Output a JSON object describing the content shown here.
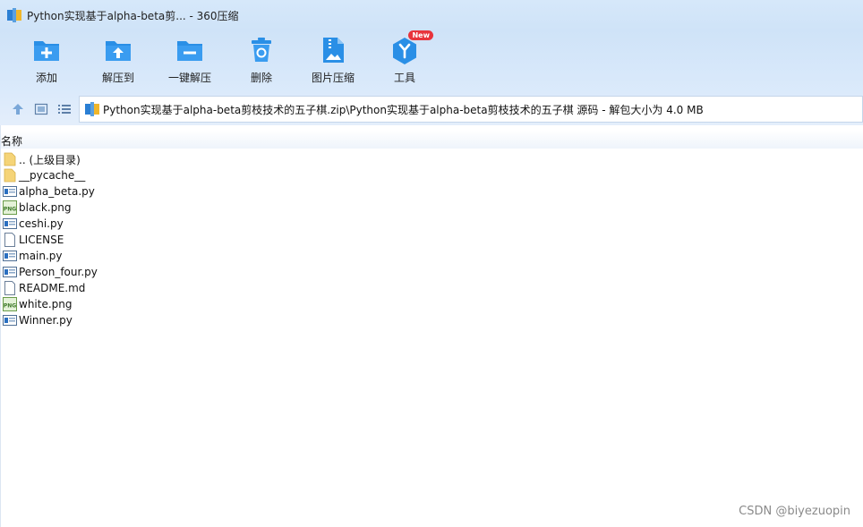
{
  "window": {
    "title": "Python实现基于alpha-beta剪... - 360压缩"
  },
  "toolbar": {
    "items": [
      {
        "label": "添加",
        "icon": "add-folder-icon"
      },
      {
        "label": "解压到",
        "icon": "extract-to-icon"
      },
      {
        "label": "一键解压",
        "icon": "one-click-extract-icon"
      },
      {
        "label": "删除",
        "icon": "trash-icon"
      },
      {
        "label": "图片压缩",
        "icon": "image-compress-icon"
      },
      {
        "label": "工具",
        "icon": "tools-icon",
        "badge": "New"
      }
    ]
  },
  "address": {
    "path": "Python实现基于alpha-beta剪枝技术的五子棋.zip\\Python实现基于alpha-beta剪枝技术的五子棋 源码 - 解包大小为 4.0 MB"
  },
  "columns": {
    "name": "名称"
  },
  "files": [
    {
      "name": ".. (上级目录)",
      "type": "folder"
    },
    {
      "name": "__pycache__",
      "type": "folder"
    },
    {
      "name": "alpha_beta.py",
      "type": "py"
    },
    {
      "name": "black.png",
      "type": "png"
    },
    {
      "name": "ceshi.py",
      "type": "py"
    },
    {
      "name": "LICENSE",
      "type": "file"
    },
    {
      "name": "main.py",
      "type": "py"
    },
    {
      "name": "Person_four.py",
      "type": "py"
    },
    {
      "name": "README.md",
      "type": "file"
    },
    {
      "name": "white.png",
      "type": "png"
    },
    {
      "name": "Winner.py",
      "type": "py"
    }
  ],
  "watermark": "CSDN @biyezuopin",
  "colors": {
    "accent": "#2a8fe6",
    "badge": "#e8343c",
    "folder": "#f5d478"
  }
}
